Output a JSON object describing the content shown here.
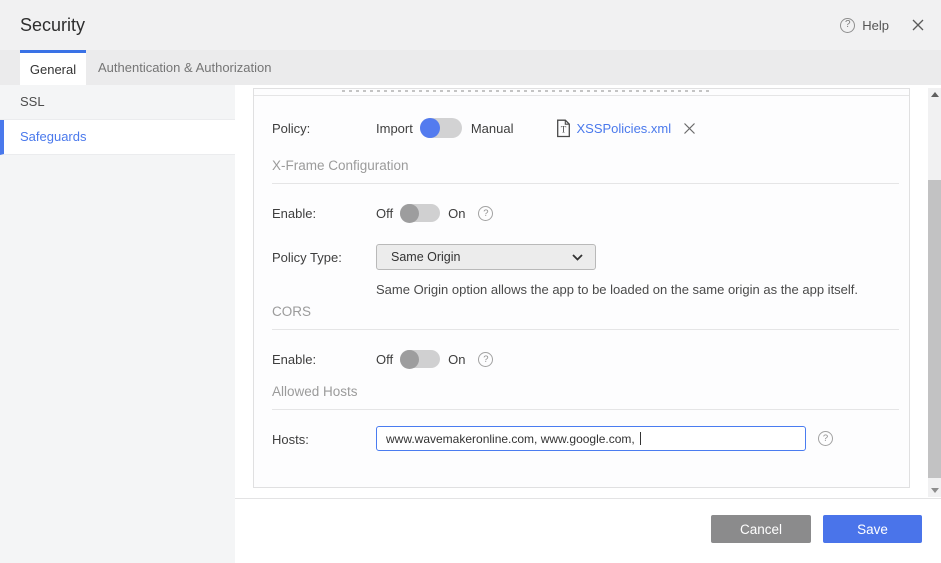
{
  "window": {
    "title": "Security",
    "help": "Help"
  },
  "tabs": [
    {
      "label": "General",
      "active": true
    },
    {
      "label": "Authentication & Authorization",
      "active": false
    }
  ],
  "sidebar": [
    {
      "label": "SSL",
      "active": false
    },
    {
      "label": "Safeguards",
      "active": true
    }
  ],
  "panel": {
    "policy_row": {
      "label": "Policy:",
      "left_option": "Import",
      "right_option": "Manual",
      "selected": "Import",
      "file": "XSSPolicies.xml"
    },
    "xframe": {
      "title": "X-Frame Configuration",
      "enable_label": "Enable:",
      "off": "Off",
      "on": "On",
      "state": "Off",
      "policy_type_label": "Policy Type:",
      "policy_type": "Same Origin",
      "hint": "Same Origin option allows the app to be loaded on the same origin as the app itself."
    },
    "cors": {
      "title": "CORS",
      "enable_label": "Enable:",
      "off": "Off",
      "on": "On",
      "state": "Off"
    },
    "allowed_hosts": {
      "title": "Allowed Hosts",
      "label": "Hosts:",
      "value": "www.wavemakeronline.com, www.google.com, "
    }
  },
  "footer": {
    "cancel": "Cancel",
    "save": "Save"
  },
  "colors": {
    "accent_blue": "#4a74ea",
    "link_blue": "#4a79ec",
    "toggle_on_blue": "#537bef",
    "toggle_off_gray": "#9d9d9e",
    "cancel_gray": "#8b8b8c",
    "section_gray": "#9b9b9b"
  }
}
